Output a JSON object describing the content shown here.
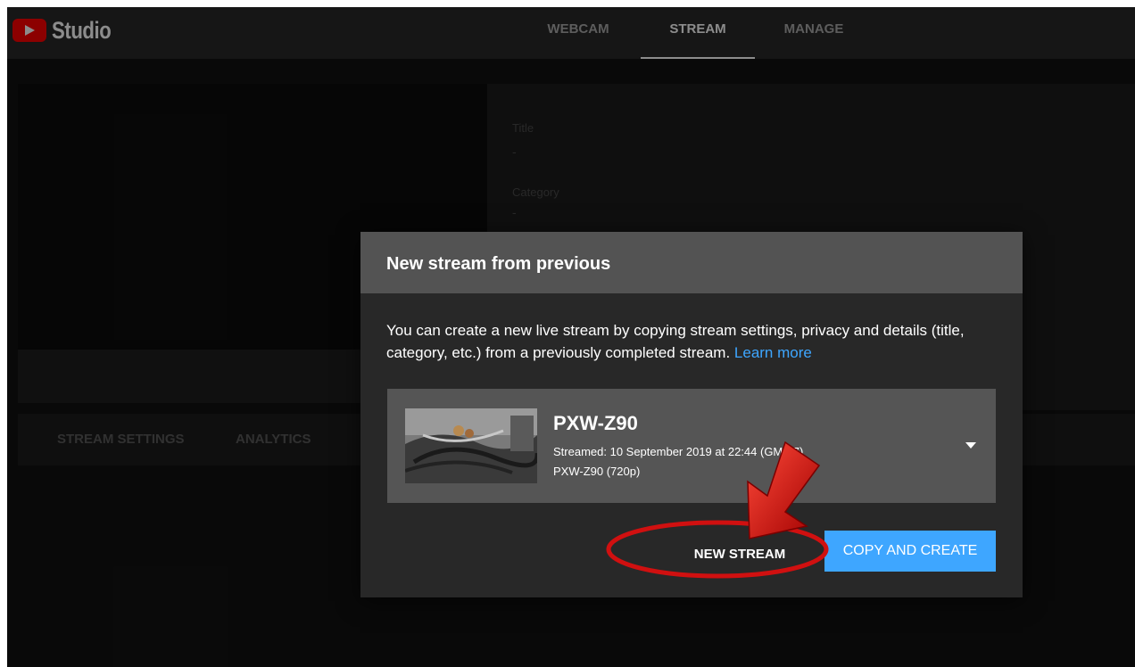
{
  "app": {
    "logo_text": "Studio"
  },
  "nav": {
    "tabs": [
      {
        "label": "WEBCAM",
        "active": false
      },
      {
        "label": "STREAM",
        "active": true
      },
      {
        "label": "MANAGE",
        "active": false
      }
    ]
  },
  "details": {
    "title_label": "Title",
    "title_value": "-",
    "category_label": "Category",
    "category_value": "-"
  },
  "bottom_tabs": [
    "STREAM SETTINGS",
    "ANALYTICS"
  ],
  "dialog": {
    "title": "New stream from previous",
    "body": "You can create a new live stream by copying stream settings, privacy and details (title, category, etc.) from a previously completed stream.",
    "learn_more": "Learn more",
    "stream": {
      "name": "PXW-Z90",
      "streamed": "Streamed: 10 September 2019 at 22:44 (GMT-7)",
      "source": "PXW-Z90 (720p)"
    },
    "new_stream_label": "NEW STREAM",
    "copy_create_label": "COPY AND CREATE"
  },
  "colors": {
    "accent": "#3ea6ff",
    "brand_red": "#ff0000",
    "annotation_red": "#d01010"
  },
  "icons": [
    "youtube-play-icon",
    "dropdown-arrow-icon"
  ]
}
